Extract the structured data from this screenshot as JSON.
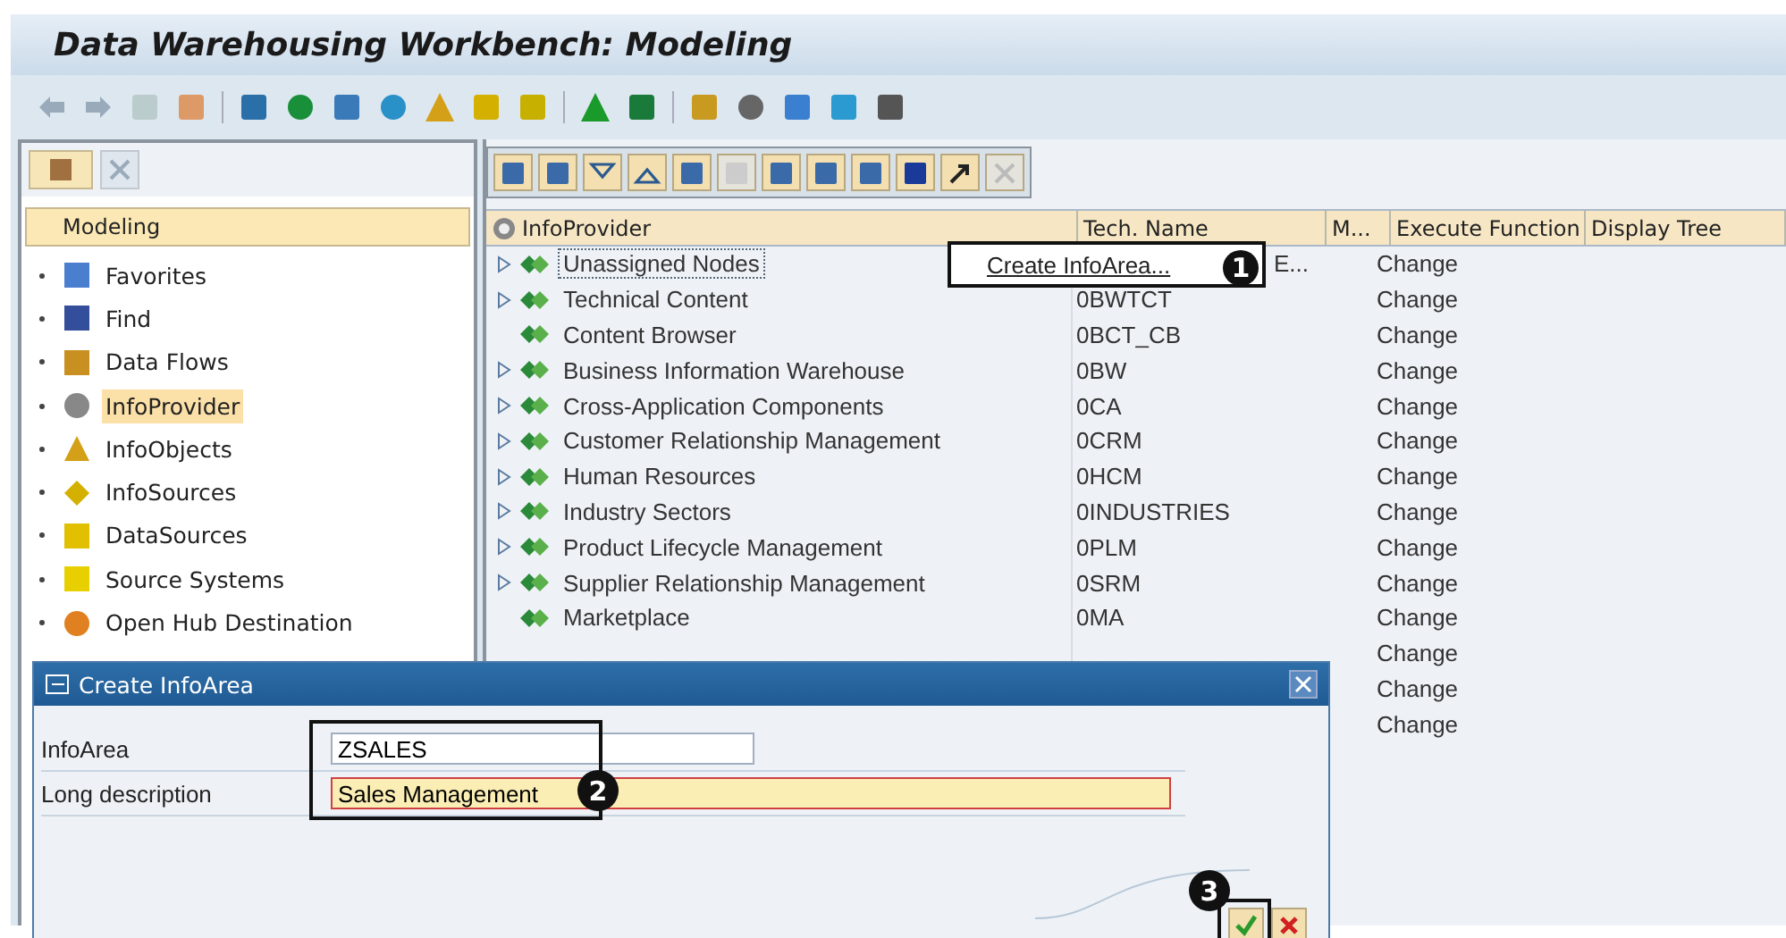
{
  "window": {
    "title": "Data Warehousing Workbench: Modeling"
  },
  "sidebar": {
    "header": "Modeling",
    "items": [
      {
        "label": "Favorites",
        "selected": false
      },
      {
        "label": "Find",
        "selected": false
      },
      {
        "label": "Data Flows",
        "selected": false
      },
      {
        "label": "InfoProvider",
        "selected": true
      },
      {
        "label": "InfoObjects",
        "selected": false
      },
      {
        "label": "InfoSources",
        "selected": false
      },
      {
        "label": "DataSources",
        "selected": false
      },
      {
        "label": "Source Systems",
        "selected": false
      },
      {
        "label": "Open Hub Destination",
        "selected": false
      }
    ]
  },
  "table": {
    "columns": [
      "InfoProvider",
      "Tech. Name",
      "M...",
      "Execute Function",
      "Display Tree"
    ],
    "rows": [
      {
        "expandable": true,
        "name": "Unassigned Nodes",
        "tech": "E...",
        "execute": "Change",
        "focused": true
      },
      {
        "expandable": true,
        "name": "Technical Content",
        "tech": "0BWTCT",
        "execute": "Change",
        "focused": false
      },
      {
        "expandable": false,
        "name": "Content Browser",
        "tech": "0BCT_CB",
        "execute": "Change",
        "focused": false
      },
      {
        "expandable": true,
        "name": "Business Information Warehouse",
        "tech": "0BW",
        "execute": "Change",
        "focused": false
      },
      {
        "expandable": true,
        "name": "Cross-Application Components",
        "tech": "0CA",
        "execute": "Change",
        "focused": false
      },
      {
        "expandable": true,
        "name": "Customer Relationship Management",
        "tech": "0CRM",
        "execute": "Change",
        "focused": false
      },
      {
        "expandable": true,
        "name": "Human Resources",
        "tech": "0HCM",
        "execute": "Change",
        "focused": false
      },
      {
        "expandable": true,
        "name": "Industry Sectors",
        "tech": "0INDUSTRIES",
        "execute": "Change",
        "focused": false
      },
      {
        "expandable": true,
        "name": "Product Lifecycle Management",
        "tech": "0PLM",
        "execute": "Change",
        "focused": false
      },
      {
        "expandable": true,
        "name": "Supplier Relationship Management",
        "tech": "0SRM",
        "execute": "Change",
        "focused": false
      },
      {
        "expandable": false,
        "name": "Marketplace",
        "tech": "0MA",
        "execute": "Change",
        "focused": false
      },
      {
        "execute": "Change"
      },
      {
        "execute": "Change"
      },
      {
        "execute": "Change"
      }
    ]
  },
  "context_menu": {
    "items": [
      "Create InfoArea..."
    ],
    "callout": "1"
  },
  "dialog": {
    "title": "Create InfoArea",
    "fields": [
      {
        "label": "InfoArea",
        "value": "ZSALES",
        "required": false
      },
      {
        "label": "Long description",
        "value": "Sales Management",
        "required": true
      }
    ],
    "field_callout": "2",
    "button_callout": "3"
  }
}
